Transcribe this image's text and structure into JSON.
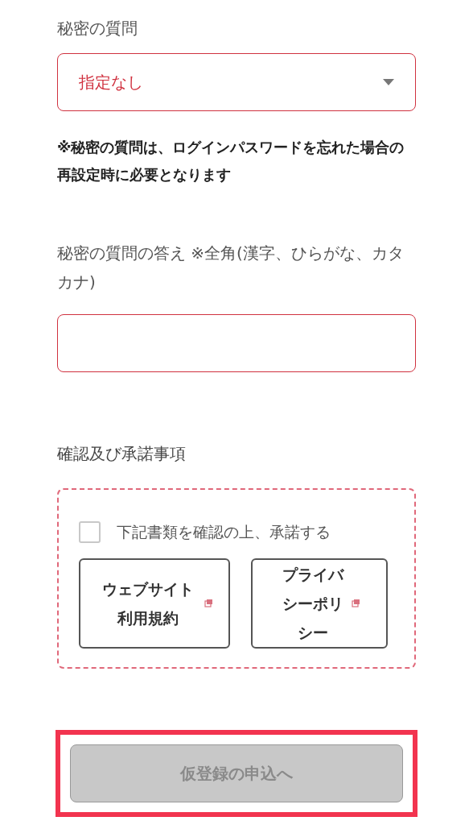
{
  "secret_question": {
    "label": "秘密の質問",
    "value": "指定なし",
    "note": "※秘密の質問は、ログインパスワードを忘れた場合の再設定時に必要となります"
  },
  "secret_answer": {
    "label": "秘密の質問の答え ※全角(漢字、ひらがな、カタカナ)"
  },
  "agreement": {
    "heading": "確認及び承諾事項",
    "checkbox": {
      "label": "下記書類を確認の上、承諾する",
      "checked": false
    },
    "links": [
      {
        "label": "ウェブサイト利用規約"
      },
      {
        "label": "プライバシーポリシー"
      }
    ]
  },
  "submit": {
    "label": "仮登録の申込へ",
    "disabled": true,
    "highlighted": true
  }
}
